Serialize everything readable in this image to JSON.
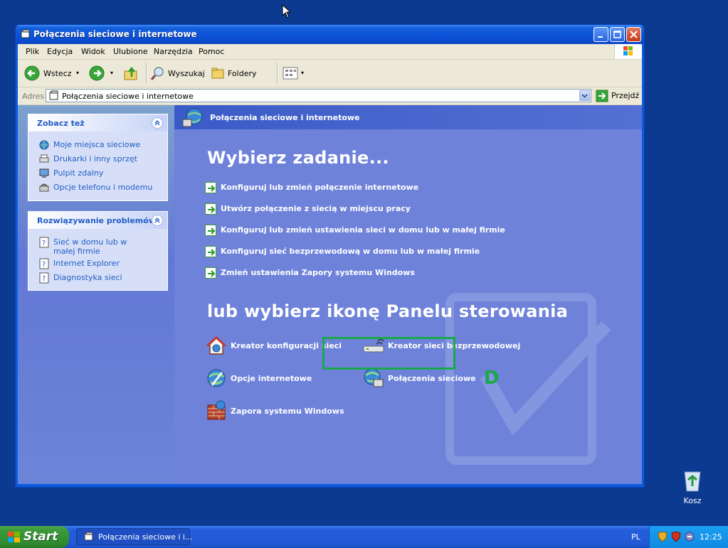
{
  "window": {
    "title": "Połączenia sieciowe i internetowe",
    "menu": [
      "Plik",
      "Edycja",
      "Widok",
      "Ulubione",
      "Narzędzia",
      "Pomoc"
    ],
    "toolbar": {
      "back_label": "Wstecz",
      "search_label": "Wyszukaj",
      "folders_label": "Foldery"
    },
    "address": {
      "label": "Adres",
      "value": "Połączenia sieciowe i internetowe",
      "go_label": "Przejdź"
    }
  },
  "sidebar": {
    "see_also": {
      "title": "Zobacz też",
      "items": [
        {
          "label": "Moje miejsca sieciowe",
          "icon": "network-places-icon"
        },
        {
          "label": "Drukarki i inny sprzęt",
          "icon": "printer-icon"
        },
        {
          "label": "Pulpit zdalny",
          "icon": "remote-desktop-icon"
        },
        {
          "label": "Opcje telefonu i modemu",
          "icon": "phone-modem-icon"
        }
      ]
    },
    "troubleshooting": {
      "title": "Rozwiązywanie problemów",
      "items": [
        {
          "label": "Sieć w domu lub w małej firmie",
          "icon": "help-icon"
        },
        {
          "label": "Internet Explorer",
          "icon": "help-icon"
        },
        {
          "label": "Diagnostyka sieci",
          "icon": "help-icon"
        }
      ]
    }
  },
  "main": {
    "header": "Połączenia sieciowe i internetowe",
    "pick_task": "Wybierz zadanie...",
    "tasks": [
      "Konfiguruj lub zmień połączenie internetowe",
      "Utwórz połączenie z siecią w miejscu pracy",
      "Konfiguruj lub zmień ustawienia sieci w domu lub w małej firmie",
      "Konfiguruj sieć bezprzewodową w domu lub w małej firmie",
      "Zmień ustawienia Zapory systemu Windows"
    ],
    "pick_icon": "lub wybierz ikonę Panelu sterowania",
    "icons": [
      {
        "label": "Kreator konfiguracji sieci",
        "icon": "network-setup-icon"
      },
      {
        "label": "Kreator sieci bezprzewodowej",
        "icon": "wireless-icon"
      },
      {
        "label": "Opcje internetowe",
        "icon": "internet-options-icon"
      },
      {
        "label": "Połączenia sieciowe",
        "icon": "network-connections-icon"
      },
      {
        "label": "Zapora systemu Windows",
        "icon": "firewall-icon"
      }
    ],
    "annotation_letter": "D"
  },
  "desktop": {
    "recycle_bin": "Kosz"
  },
  "taskbar": {
    "start": "Start",
    "task": "Połączenia sieciowe i i...",
    "lang": "PL",
    "clock": "12:25"
  }
}
